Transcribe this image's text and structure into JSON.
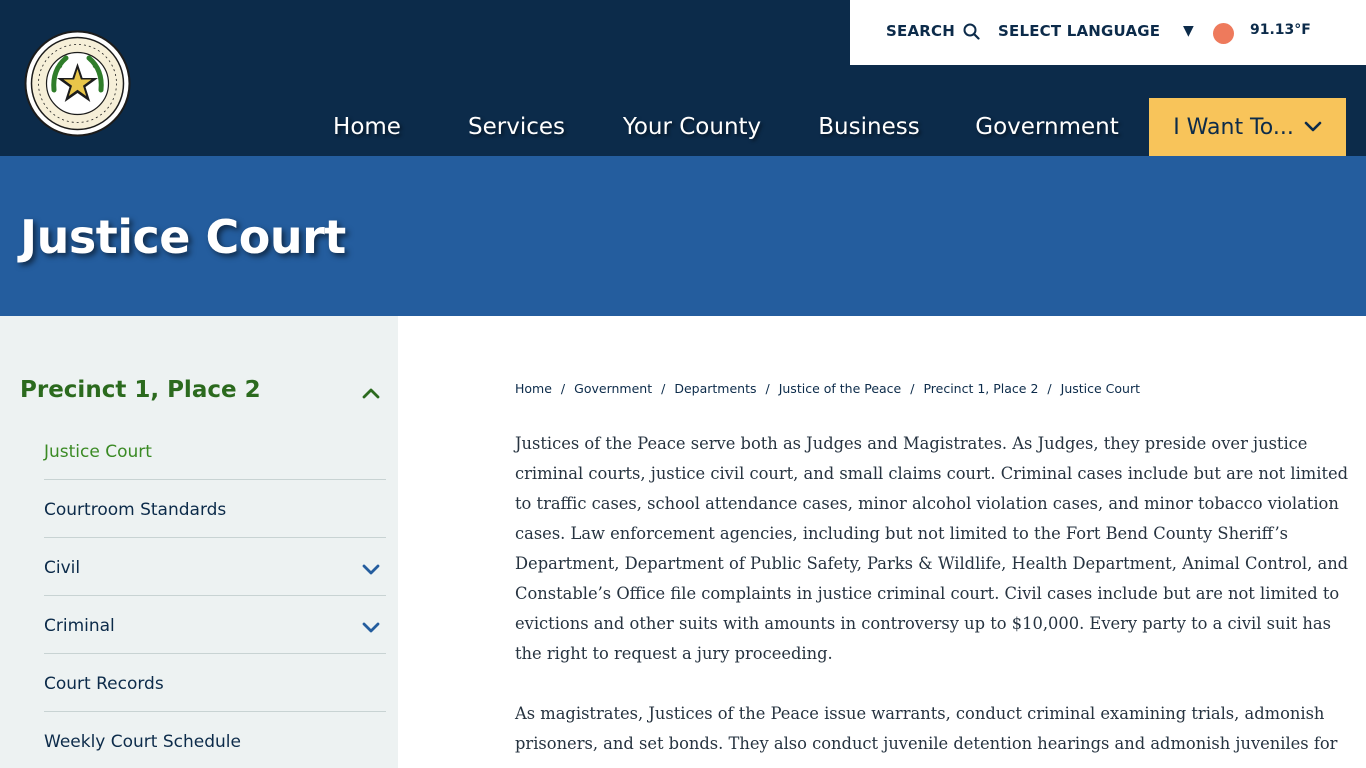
{
  "header": {
    "logo_alt": "The State of Texas Fort Bend County seal",
    "search_label": "SEARCH",
    "language_label": "SELECT LANGUAGE",
    "temperature": "91.13°F",
    "nav": [
      {
        "label": "Home"
      },
      {
        "label": "Services"
      },
      {
        "label": "Your County"
      },
      {
        "label": "Business"
      },
      {
        "label": "Government"
      }
    ],
    "want_label": "I Want To..."
  },
  "banner": {
    "title": "Justice Court"
  },
  "sidebar": {
    "heading": "Precinct 1, Place 2",
    "items": [
      {
        "label": "Justice Court",
        "active": true
      },
      {
        "label": "Courtroom Standards"
      },
      {
        "label": "Civil",
        "expandable": true
      },
      {
        "label": "Criminal",
        "expandable": true
      },
      {
        "label": "Court Records"
      },
      {
        "label": "Weekly Court Schedule"
      }
    ]
  },
  "breadcrumb": [
    "Home",
    "Government",
    "Departments",
    "Justice of the Peace",
    "Precinct 1, Place 2",
    "Justice Court"
  ],
  "content": {
    "paragraph1": "Justices of the Peace serve both as Judges and Magistrates. As Judges, they preside over justice criminal courts, justice civil court, and small claims court. Criminal cases include but are not limited to traffic cases, school attendance cases, minor alcohol violation cases, and minor tobacco violation cases. Law enforcement agencies, including but not limited to the Fort Bend County Sheriff’s Department, Department of Public Safety, Parks & Wildlife, Health Department, Animal Control, and Constable’s Office file complaints in justice criminal court. Civil cases include but are not limited to evictions and other suits with amounts in controversy up to $10,000. Every party to a civil suit has the right to request a jury proceeding.",
    "paragraph2": "As magistrates, Justices of the Peace issue warrants, conduct criminal examining trials, admonish prisoners, and set bonds. They also conduct juvenile detention hearings and admonish juveniles for"
  },
  "colors": {
    "header_bg": "#0c2b4a",
    "banner_bg": "#245d9e",
    "accent_yellow": "#f8c45a",
    "sidebar_green": "#2b6a1e",
    "active_green": "#3a8a24",
    "weather_dot": "#ee7a5c"
  }
}
